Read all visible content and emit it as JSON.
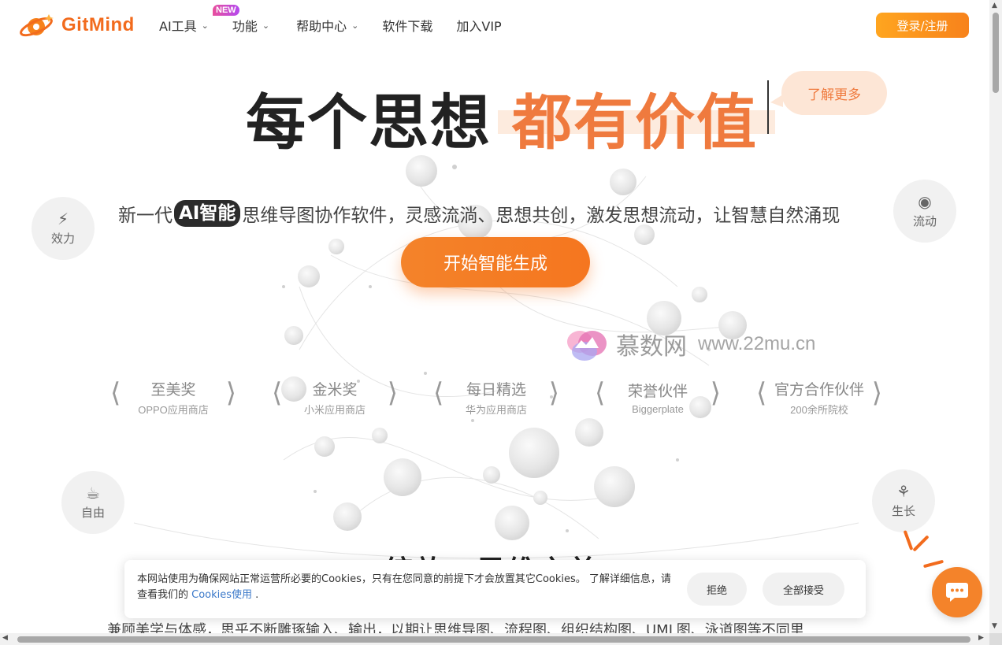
{
  "header": {
    "logo_text": "GitMind",
    "nav": [
      {
        "label": "AI工具",
        "has_dropdown": true,
        "badge": "NEW"
      },
      {
        "label": "功能",
        "has_dropdown": true
      },
      {
        "label": "帮助中心",
        "has_dropdown": true
      },
      {
        "label": "软件下载",
        "has_dropdown": false
      },
      {
        "label": "加入VIP",
        "has_dropdown": false
      }
    ],
    "login_label": "登录/注册"
  },
  "hero": {
    "headline_dark": "每个思想",
    "headline_orange": "都有价值",
    "learn_more": "了解更多",
    "subtitle_prefix": "新一代",
    "subtitle_pill": "AI智能",
    "subtitle_suffix": "思维导图协作软件，灵感流淌、思想共创，激发思想流动，让智慧自然涌现",
    "cta": "开始智能生成",
    "side_items": [
      {
        "label": "效力",
        "icon": "lightning-icon"
      },
      {
        "label": "流动",
        "icon": "globe-icon"
      },
      {
        "label": "自由",
        "icon": "coffee-icon"
      },
      {
        "label": "生长",
        "icon": "sprout-icon"
      }
    ],
    "awards": [
      {
        "title": "至美奖",
        "sub": "OPPO应用商店"
      },
      {
        "title": "金米奖",
        "sub": "小米应用商店"
      },
      {
        "title": "每日精选",
        "sub": "华为应用商店"
      },
      {
        "title": "荣誉伙伴",
        "sub": "Biggerplate"
      },
      {
        "title": "官方合作伙伴",
        "sub": "200余所院校"
      }
    ]
  },
  "watermark": {
    "name": "慕数网",
    "url": "www.22mu.cn"
  },
  "section2": {
    "title": "绽放，思维之美",
    "subtitle": "兼顾美学与体感，思乎不断雕琢输入、输出，以期让思维导图、流程图、组织结构图、UML图、泳道图等不同里"
  },
  "cookie": {
    "text": "本网站使用为确保网站正常运营所必要的Cookies，只有在您同意的前提下才会放置其它Cookies。 了解详细信息，请查看我们的 ",
    "link": "Cookies使用",
    "after_link": " .",
    "reject": "拒绝",
    "accept": "全部接受"
  },
  "colors": {
    "brand_orange": "#f4832a",
    "headline_orange": "#ef7a3e",
    "dark": "#222222"
  }
}
